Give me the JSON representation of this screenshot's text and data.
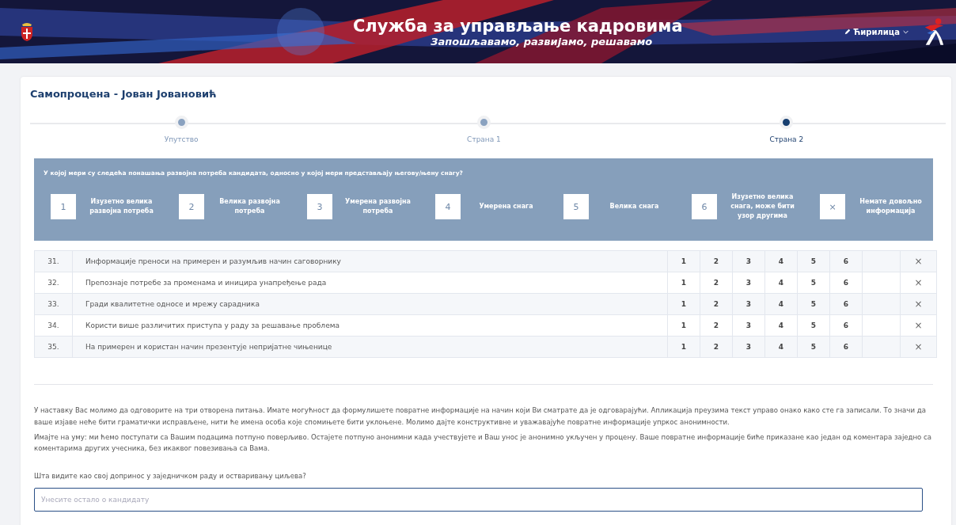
{
  "header": {
    "title": "Служба за управљање кадровима",
    "subtitle": "Запошљавамо, развијамо, решавамо",
    "language": "Ћирилица"
  },
  "page_title": "Самопроцена - Јован Јовановић",
  "steps": [
    {
      "label": "Упутство",
      "selected": false
    },
    {
      "label": "Страна 1",
      "selected": false
    },
    {
      "label": "Страна 2",
      "selected": true
    }
  ],
  "legend": {
    "question": "У којој мери су следећа понашања развојна потреба кандидата, односно у којој мери представљају његову/њену снагу?",
    "items": [
      {
        "key": "1",
        "label": "Изузетно велика развојна потреба"
      },
      {
        "key": "2",
        "label": "Велика развојна потреба"
      },
      {
        "key": "3",
        "label": "Умерена развојна потреба"
      },
      {
        "key": "4",
        "label": "Умерена снага"
      },
      {
        "key": "5",
        "label": "Велика снага"
      },
      {
        "key": "6",
        "label": "Изузетно велика снага, може бити узор другима"
      },
      {
        "key": "×",
        "label": "Немате довољно информација"
      }
    ]
  },
  "rows": [
    {
      "number": "31.",
      "text": "Информације преноси на примерен и разумљив начин саговорнику",
      "options": [
        "1",
        "2",
        "3",
        "4",
        "5",
        "6"
      ],
      "none": "×"
    },
    {
      "number": "32.",
      "text": "Препознаје потребе за променама и иницира унапређење рада",
      "options": [
        "1",
        "2",
        "3",
        "4",
        "5",
        "6"
      ],
      "none": "×"
    },
    {
      "number": "33.",
      "text": "Гради квалитетне односе и мрежу сарадника",
      "options": [
        "1",
        "2",
        "3",
        "4",
        "5",
        "6"
      ],
      "none": "×"
    },
    {
      "number": "34.",
      "text": "Користи више различитих приступа у раду за решавање проблема",
      "options": [
        "1",
        "2",
        "3",
        "4",
        "5",
        "6"
      ],
      "none": "×"
    },
    {
      "number": "35.",
      "text": "На примерен и користан начин презентује непријатне чињенице",
      "options": [
        "1",
        "2",
        "3",
        "4",
        "5",
        "6"
      ],
      "none": "×"
    }
  ],
  "paragraphs": [
    "У наставку Вас молимо да одговорите на три отворена питања. Имате могућност да формулишете повратне информације на начин који Ви сматрате да је одговарајући. Апликација преузима текст управо онако како сте га записали. То значи да ваше изјаве неће бити граматички исправљене, нити ће имена особа које спомињете бити уклоњене. Молимо дајте конструктивне и уважавајуће повратне информације упркос анонимности.",
    "Имајте на уму: ми ћемо поступати са Вашим подацима потпуно поверљиво. Остајете потпуно анонимни када учествујете и Ваш унос је анонимно укључен у процену. Ваше повратне информације биће приказане као један од коментара заједно са коментарима других учесника, без икаквог повезивања са Вама."
  ],
  "question": {
    "label": "Шта видите као свој допринос у заједничком раду и остваривању циљева?",
    "placeholder": "Унесите остало о кандидату"
  }
}
